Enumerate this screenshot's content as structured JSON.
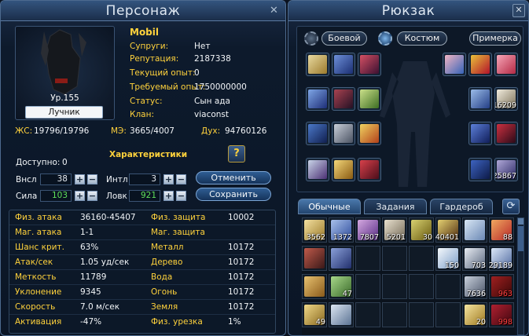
{
  "character": {
    "title": "Персонаж",
    "name": "Mobil",
    "level": "Ур.155",
    "class": "Лучник",
    "info": [
      {
        "label": "Супруги:",
        "value": "Нет"
      },
      {
        "label": "Репутация:",
        "value": "2187338"
      },
      {
        "label": "Текущий опыт:",
        "value": "0"
      },
      {
        "label": "Требуемый опыт:",
        "value": "1750000000"
      },
      {
        "label": "Статус:",
        "value": "Сын ада"
      },
      {
        "label": "Клан:",
        "value": "viaconst"
      }
    ],
    "hp_label": "ЖС:",
    "hp": "19796/19796",
    "mp_label": "МЭ:",
    "mp": "3665/4007",
    "spirit_label": "Дух:",
    "spirit": "94760126",
    "stats_title": "Характеристики",
    "help": "?",
    "available_label": "Доступно:",
    "available": "0",
    "stats": {
      "vit": {
        "label": "Внсл",
        "value": "38"
      },
      "int": {
        "label": "Интл",
        "value": "3"
      },
      "str": {
        "label": "Сила",
        "base": "",
        "value": "103"
      },
      "dex": {
        "label": "Ловк",
        "base": "",
        "value": "921"
      }
    },
    "cancel": "Отменить",
    "save": "Сохранить",
    "table": [
      [
        "Физ. атака",
        "36160-45407",
        "Физ. защита",
        "10002"
      ],
      [
        "Маг. атака",
        "1-1",
        "Маг. защита",
        ""
      ],
      [
        "Шанс крит.",
        "63%",
        "Металл",
        "10172"
      ],
      [
        "Атак/сек",
        "1.05 уд/сек",
        "Дерево",
        "10172"
      ],
      [
        "Меткость",
        "11789",
        "Вода",
        "10172"
      ],
      [
        "Уклонение",
        "9345",
        "Огонь",
        "10172"
      ],
      [
        "Скорость",
        "7.0 м/сек",
        "Земля",
        "10172"
      ],
      [
        "Активация",
        "-47%",
        "Физ. урезка",
        "1%"
      ]
    ]
  },
  "backpack": {
    "title": "Рюкзак",
    "mode_combat": "Боевой",
    "mode_costume": "Костюм",
    "fitting": "Примерка",
    "equip_counts": [
      "16209",
      "25867"
    ],
    "tabs": [
      "Обычные",
      "Задания",
      "Гардероб"
    ],
    "grid_counts": [
      "3562",
      "1372",
      "7807",
      "5201",
      "30",
      "40401",
      "88",
      "150",
      "703",
      "29189",
      "7636",
      "963",
      "20",
      "998",
      "47",
      "49"
    ]
  },
  "colors": {
    "accent": "#ffd23c",
    "frame": "#4d6a8e",
    "title_bg": "#1b2e4a"
  }
}
